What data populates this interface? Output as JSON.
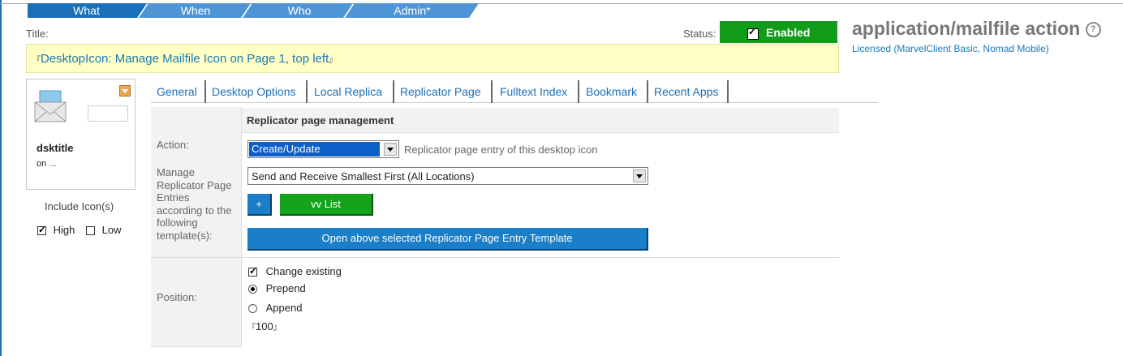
{
  "steps": [
    "What",
    "When",
    "Who",
    "Admin*"
  ],
  "title_label": "Title:",
  "title_value": "DesktopIcon: Manage Mailfile Icon on Page 1, top left",
  "status": {
    "label": "Status:",
    "value": "Enabled",
    "checked": true
  },
  "app": {
    "title": "application/mailfile action",
    "help_glyph": "?",
    "licensed": "Licensed (MarvelClient Basic, Nomad Mobile)"
  },
  "icon_card": {
    "title": "dsktitle",
    "subtitle": "on ...",
    "include_label": "Include Icon(s)",
    "high_label": "High",
    "low_label": "Low",
    "high_checked": true,
    "low_checked": false
  },
  "tabs": [
    "General",
    "Desktop Options",
    "Local Replica",
    "Replicator Page",
    "Fulltext Index",
    "Bookmark",
    "Recent Apps"
  ],
  "active_tab": "Replicator Page",
  "form": {
    "section_title": "Replicator page management",
    "action_label": "Action:",
    "action_value": "Create/Update",
    "action_hint": "Replicator page entry of this desktop icon",
    "manage_label": "Manage Replicator Page Entries according to the following template(s):",
    "template_value": "Send and Receive Smallest First (All Locations)",
    "add_button": "+",
    "list_button": "vv List",
    "open_button": "Open above selected Replicator Page Entry Template",
    "position_label": "Position:",
    "change_existing": "Change existing",
    "prepend": "Prepend",
    "append": "Append",
    "position_value": "100"
  }
}
